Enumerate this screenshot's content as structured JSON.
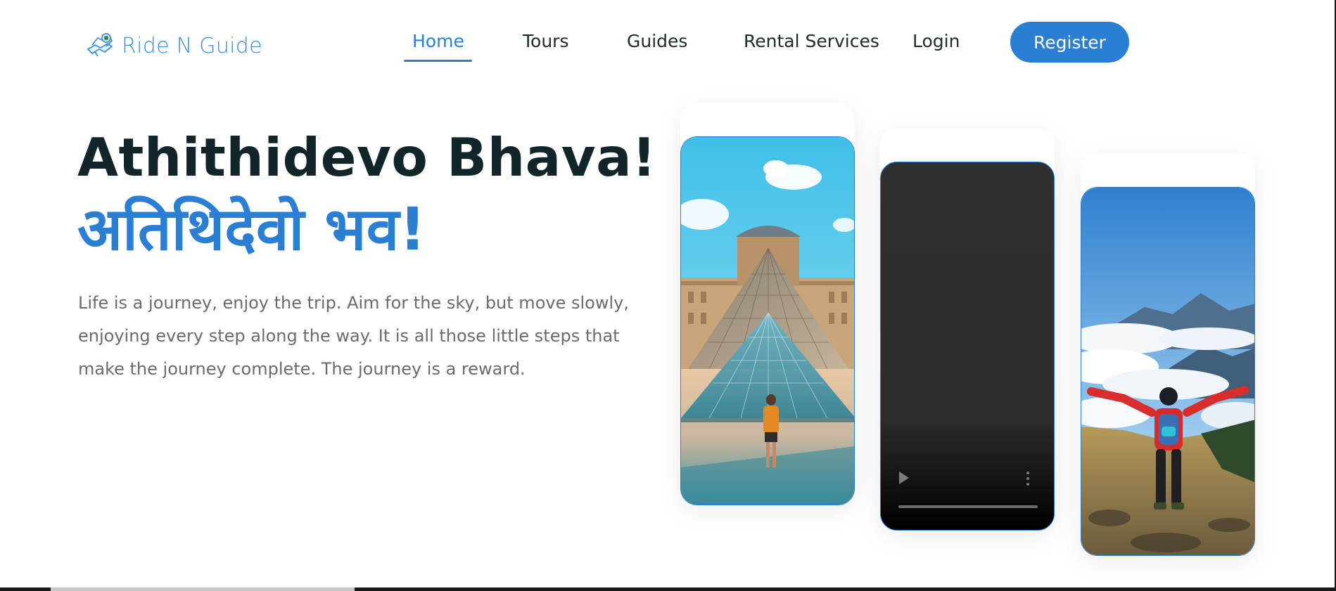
{
  "brand": {
    "name": "Ride N Guide",
    "accent": "#2a7fd4",
    "logo_icon": "map-route-icon"
  },
  "nav": {
    "items": [
      {
        "label": "Home",
        "active": true
      },
      {
        "label": "Tours",
        "active": false
      },
      {
        "label": "Guides",
        "active": false
      },
      {
        "label": "Rental Services",
        "active": false
      },
      {
        "label": "Login",
        "active": false
      }
    ],
    "register_label": "Register"
  },
  "hero": {
    "title": "Athithidevo Bhava!",
    "subtitle": "अतिथिदेवो भव!",
    "description": "Life is a journey, enjoy the trip. Aim for the sky, but move slowly, enjoying every step along the way. It is all those little steps that make the journey complete. The journey is a reward."
  },
  "cards": [
    {
      "type": "image",
      "subject": "Louvre pyramid with a traveler"
    },
    {
      "type": "video",
      "controls": [
        "play-icon",
        "more-options-icon",
        "progress-bar"
      ]
    },
    {
      "type": "image",
      "subject": "Hiker above clouds with arms raised"
    }
  ],
  "colors": {
    "title": "#12262a",
    "body_text": "#6b6b6b",
    "nav_text": "#1c2a2c"
  }
}
